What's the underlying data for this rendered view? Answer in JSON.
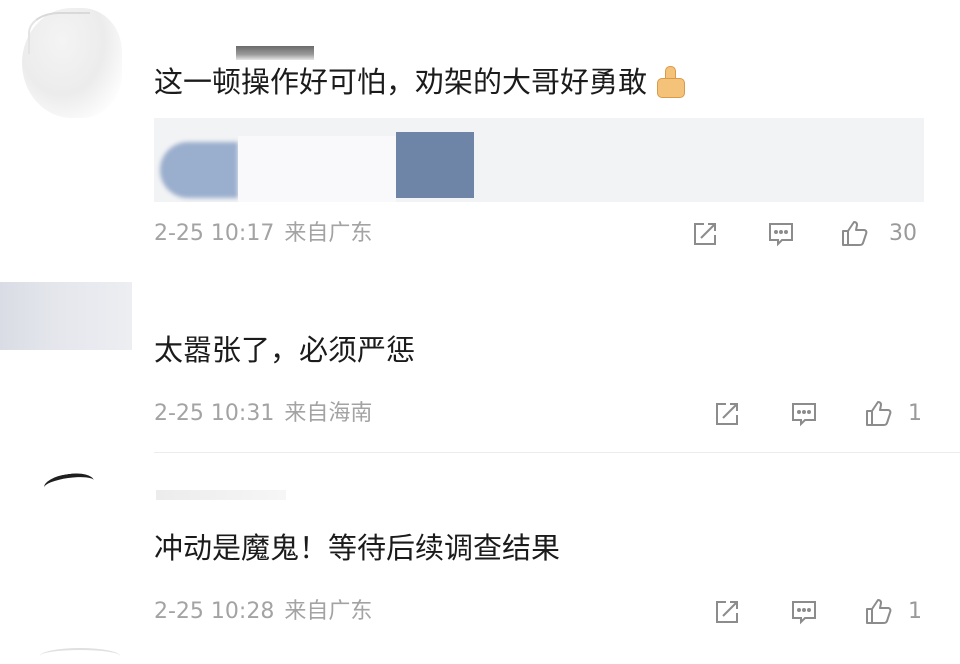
{
  "comments": [
    {
      "text": "这一顿操作好可怕，劝架的大哥好勇敢",
      "emoji": "thumbs-up-emoji",
      "time": "2-25 10:17",
      "location": "来自广东",
      "likes": "30"
    },
    {
      "text": "太嚣张了，必须严惩",
      "time": "2-25 10:31",
      "location": "来自海南",
      "likes": "1"
    },
    {
      "text": "冲动是魔鬼！等待后续调查结果",
      "time": "2-25 10:28",
      "location": "来自广东",
      "likes": "1"
    }
  ],
  "icons": {
    "share": "share-icon",
    "reply": "comment-icon",
    "like": "thumbs-up-icon"
  },
  "colors": {
    "meta_text": "#a3a3a3",
    "quote_background": "#f2f3f5"
  }
}
